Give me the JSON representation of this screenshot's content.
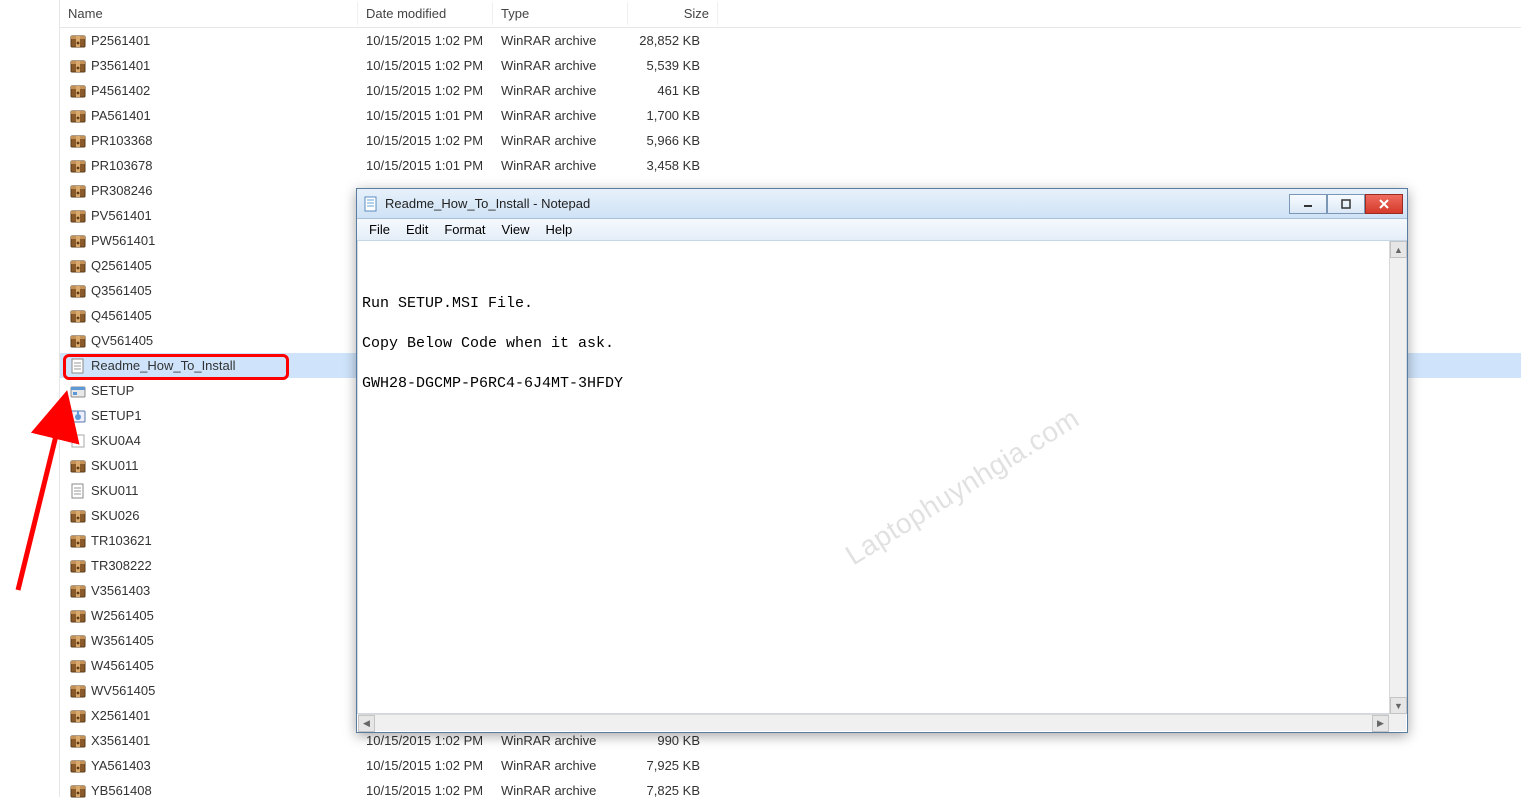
{
  "columns": {
    "name": "Name",
    "date": "Date modified",
    "type": "Type",
    "size": "Size"
  },
  "files": [
    {
      "icon": "archive",
      "name": "P2561401",
      "date": "10/15/2015 1:02 PM",
      "type": "WinRAR archive",
      "size": "28,852 KB"
    },
    {
      "icon": "archive",
      "name": "P3561401",
      "date": "10/15/2015 1:02 PM",
      "type": "WinRAR archive",
      "size": "5,539 KB"
    },
    {
      "icon": "archive",
      "name": "P4561402",
      "date": "10/15/2015 1:02 PM",
      "type": "WinRAR archive",
      "size": "461 KB"
    },
    {
      "icon": "archive",
      "name": "PA561401",
      "date": "10/15/2015 1:01 PM",
      "type": "WinRAR archive",
      "size": "1,700 KB"
    },
    {
      "icon": "archive",
      "name": "PR103368",
      "date": "10/15/2015 1:02 PM",
      "type": "WinRAR archive",
      "size": "5,966 KB"
    },
    {
      "icon": "archive",
      "name": "PR103678",
      "date": "10/15/2015 1:01 PM",
      "type": "WinRAR archive",
      "size": "3,458 KB"
    },
    {
      "icon": "archive",
      "name": "PR308246",
      "date": "",
      "type": "",
      "size": ""
    },
    {
      "icon": "archive",
      "name": "PV561401",
      "date": "",
      "type": "",
      "size": ""
    },
    {
      "icon": "archive",
      "name": "PW561401",
      "date": "",
      "type": "",
      "size": ""
    },
    {
      "icon": "archive",
      "name": "Q2561405",
      "date": "",
      "type": "",
      "size": ""
    },
    {
      "icon": "archive",
      "name": "Q3561405",
      "date": "",
      "type": "",
      "size": ""
    },
    {
      "icon": "archive",
      "name": "Q4561405",
      "date": "",
      "type": "",
      "size": ""
    },
    {
      "icon": "archive",
      "name": "QV561405",
      "date": "",
      "type": "",
      "size": ""
    },
    {
      "icon": "txt",
      "name": "Readme_How_To_Install",
      "date": "",
      "type": "",
      "size": "",
      "selected": true
    },
    {
      "icon": "msi",
      "name": "SETUP",
      "date": "",
      "type": "",
      "size": ""
    },
    {
      "icon": "setup",
      "name": "SETUP1",
      "date": "",
      "type": "",
      "size": ""
    },
    {
      "icon": "dat",
      "name": "SKU0A4",
      "date": "",
      "type": "",
      "size": ""
    },
    {
      "icon": "archive",
      "name": "SKU011",
      "date": "",
      "type": "",
      "size": ""
    },
    {
      "icon": "txt",
      "name": "SKU011",
      "date": "",
      "type": "",
      "size": ""
    },
    {
      "icon": "archive",
      "name": "SKU026",
      "date": "",
      "type": "",
      "size": ""
    },
    {
      "icon": "archive",
      "name": "TR103621",
      "date": "",
      "type": "",
      "size": ""
    },
    {
      "icon": "archive",
      "name": "TR308222",
      "date": "",
      "type": "",
      "size": ""
    },
    {
      "icon": "archive",
      "name": "V3561403",
      "date": "",
      "type": "",
      "size": ""
    },
    {
      "icon": "archive",
      "name": "W2561405",
      "date": "",
      "type": "",
      "size": ""
    },
    {
      "icon": "archive",
      "name": "W3561405",
      "date": "",
      "type": "",
      "size": ""
    },
    {
      "icon": "archive",
      "name": "W4561405",
      "date": "",
      "type": "",
      "size": ""
    },
    {
      "icon": "archive",
      "name": "WV561405",
      "date": "",
      "type": "",
      "size": ""
    },
    {
      "icon": "archive",
      "name": "X2561401",
      "date": "",
      "type": "",
      "size": ""
    },
    {
      "icon": "archive",
      "name": "X3561401",
      "date": "10/15/2015 1:02 PM",
      "type": "WinRAR archive",
      "size": "990 KB"
    },
    {
      "icon": "archive",
      "name": "YA561403",
      "date": "10/15/2015 1:02 PM",
      "type": "WinRAR archive",
      "size": "7,925 KB"
    },
    {
      "icon": "archive",
      "name": "YB561408",
      "date": "10/15/2015 1:02 PM",
      "type": "WinRAR archive",
      "size": "7,825 KB"
    }
  ],
  "notepad": {
    "title": "Readme_How_To_Install - Notepad",
    "menu": {
      "file": "File",
      "edit": "Edit",
      "format": "Format",
      "view": "View",
      "help": "Help"
    },
    "lines": [
      "Run SETUP.MSI File.",
      "",
      "Copy Below Code when it ask.",
      "",
      "GWH28-DGCMP-P6RC4-6J4MT-3HFDY"
    ]
  },
  "watermark": "Laptophuynhgia.com"
}
